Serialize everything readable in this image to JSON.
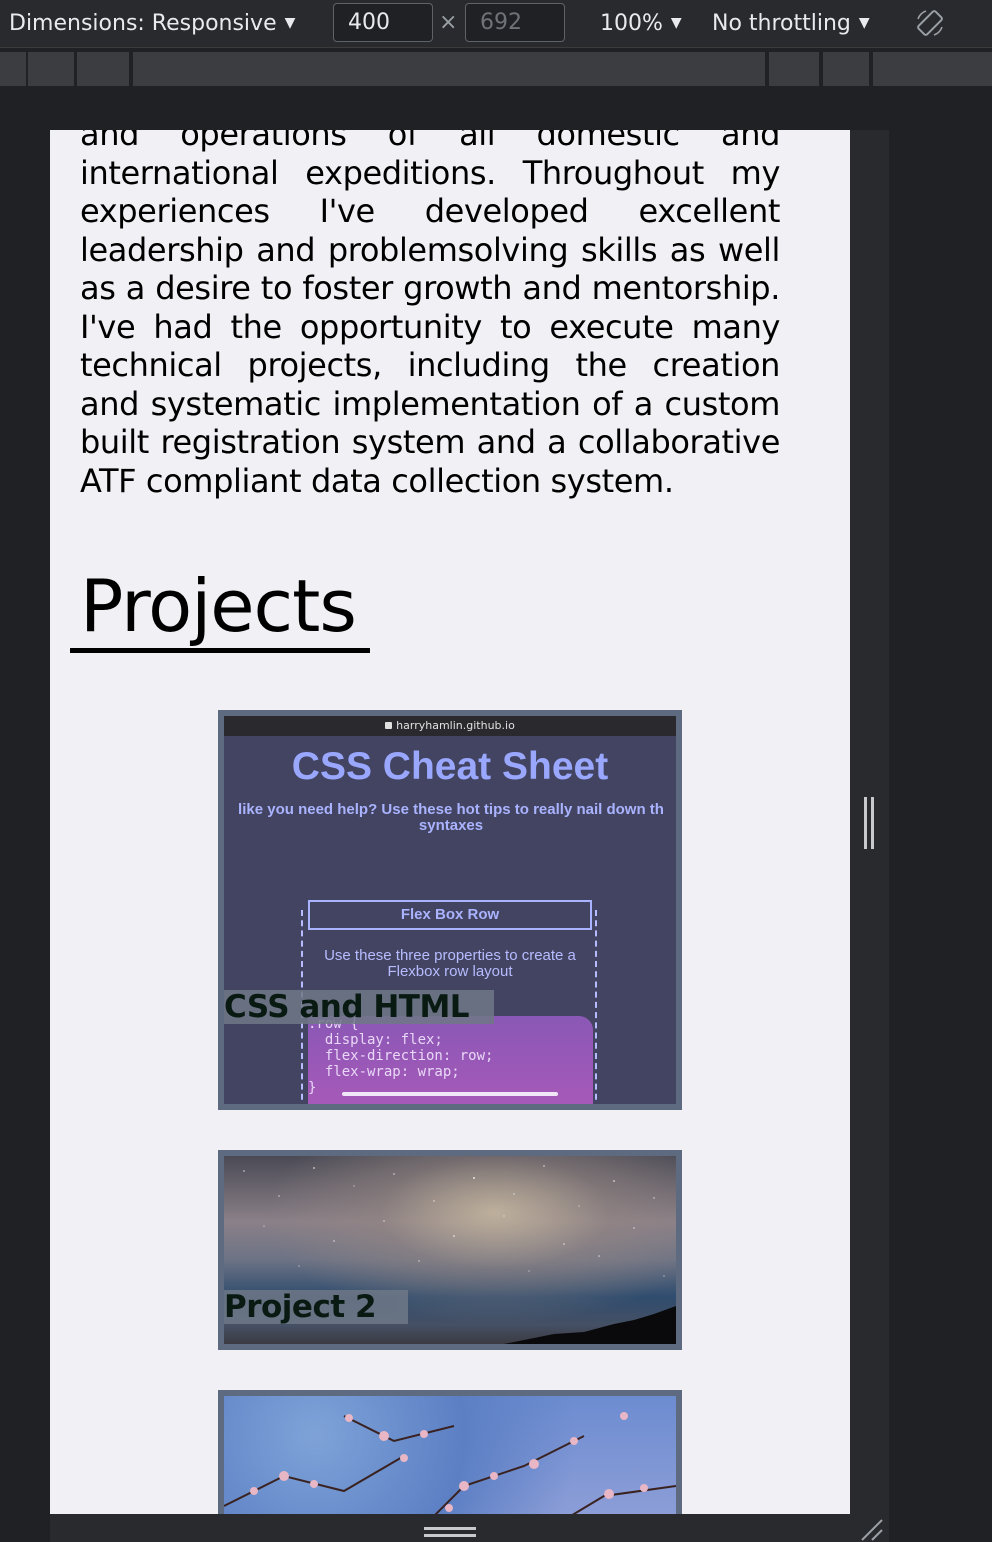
{
  "toolbar": {
    "dimensions_label": "Dimensions: Responsive",
    "width_value": "400",
    "times_symbol": "×",
    "height_value": "692",
    "zoom_label": "100%",
    "throttling_label": "No throttling",
    "caret": "▼"
  },
  "page": {
    "about_paragraph": "and operations of all domestic and international expeditions. Throughout my experiences I've developed excellent leadership and problemsolving skills as well as a desire to foster growth and mentorship. I've had the opportunity to execute many technical projects, including the creation and systematic implementation of a custom built registration system and a collaborative ATF compliant data collection system.",
    "projects_heading": "Projects",
    "projects": [
      {
        "caption": "CSS and HTML",
        "screenshot": {
          "url": "harryhamlin.github.io",
          "title": "CSS Cheat Sheet",
          "subtitle": "like you need help? Use these hot tips to really nail down th syntaxes",
          "box_label": "Flex Box Row",
          "description": "Use these three properties to create a Flexbox row layout",
          "code": ".row {\n  display: flex;\n  flex-direction: row;\n  flex-wrap: wrap;\n}"
        }
      },
      {
        "caption": "Project 2"
      },
      {
        "caption": ""
      }
    ]
  },
  "colors": {
    "devtools_bg": "#202124",
    "viewport_bg": "#f0f0f5",
    "card_border": "#5d6a80",
    "cheat_sheet_bg": "#434461",
    "cheat_sheet_accent": "#9aa7ff"
  }
}
